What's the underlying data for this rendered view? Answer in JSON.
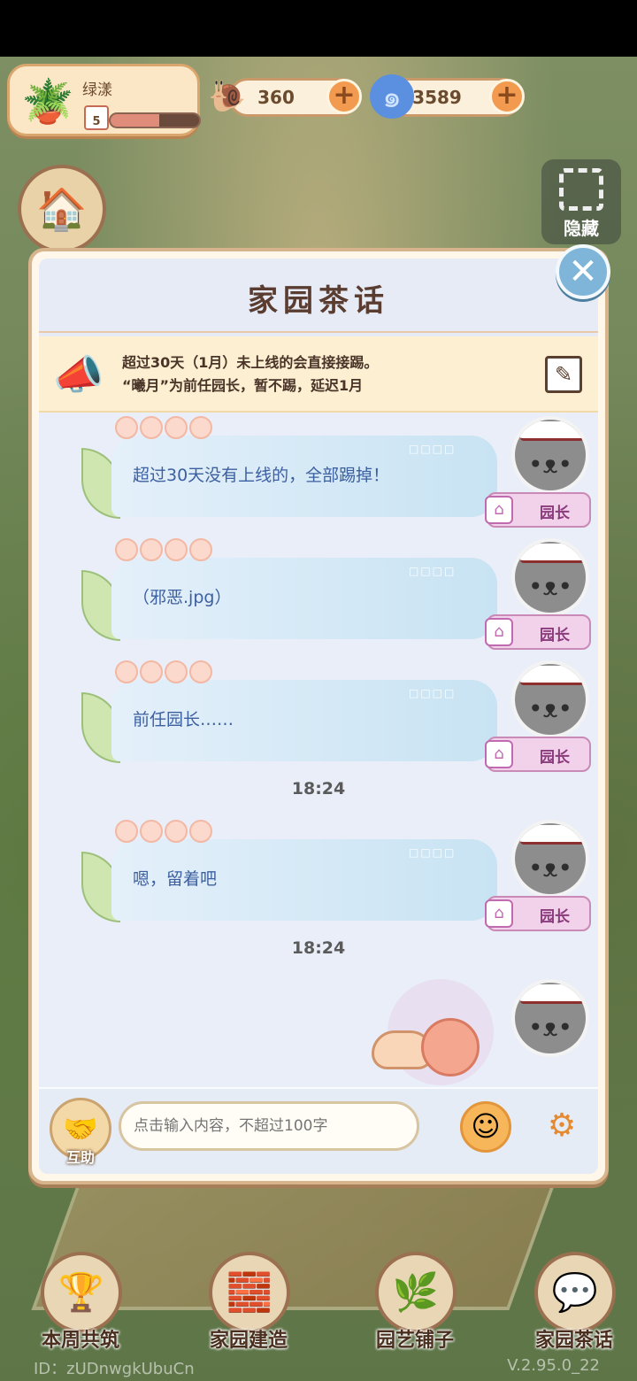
{
  "player": {
    "name": "绿漾",
    "level": "5",
    "xp_fraction": 0.55
  },
  "currencies": [
    {
      "icon": "snail-coin-icon",
      "amount": "360"
    },
    {
      "icon": "blue-swirl-gem-icon",
      "amount": "3589"
    }
  ],
  "side": {
    "hide_label": "隐藏"
  },
  "dialog": {
    "title": "家园茶话",
    "notice_line1": "超过30天（1月）未上线的会直接接踢。",
    "notice_line2": "“曦月”为前任园长，暂不踢，延迟1月",
    "messages": [
      {
        "text": "超过30天没有上线的，全部踢掉！",
        "role": "园长",
        "dots": "□□□□"
      },
      {
        "text": "（邪恶.jpg）",
        "role": "园长",
        "dots": "□□□□"
      },
      {
        "text": "前任园长……",
        "role": "园长",
        "dots": "□□□□"
      },
      {
        "text": "嗯，留着吧",
        "role": "园长",
        "dots": "□□□□"
      }
    ],
    "timestamps": [
      "18:24",
      "18:24"
    ],
    "input_placeholder": "点击输入内容，不超过100字",
    "help_label": "互助"
  },
  "bottom_nav": [
    {
      "label": "本周共筑",
      "icon": "podium-icon"
    },
    {
      "label": "家园建造",
      "icon": "brick-trowel-icon"
    },
    {
      "label": "园艺铺子",
      "icon": "flower-basket-icon"
    },
    {
      "label": "家园茶话",
      "icon": "chat-bubbles-icon"
    }
  ],
  "footer": {
    "id": "ID：zUDnwgkUbuCn",
    "version": "V.2.95.0_22"
  }
}
